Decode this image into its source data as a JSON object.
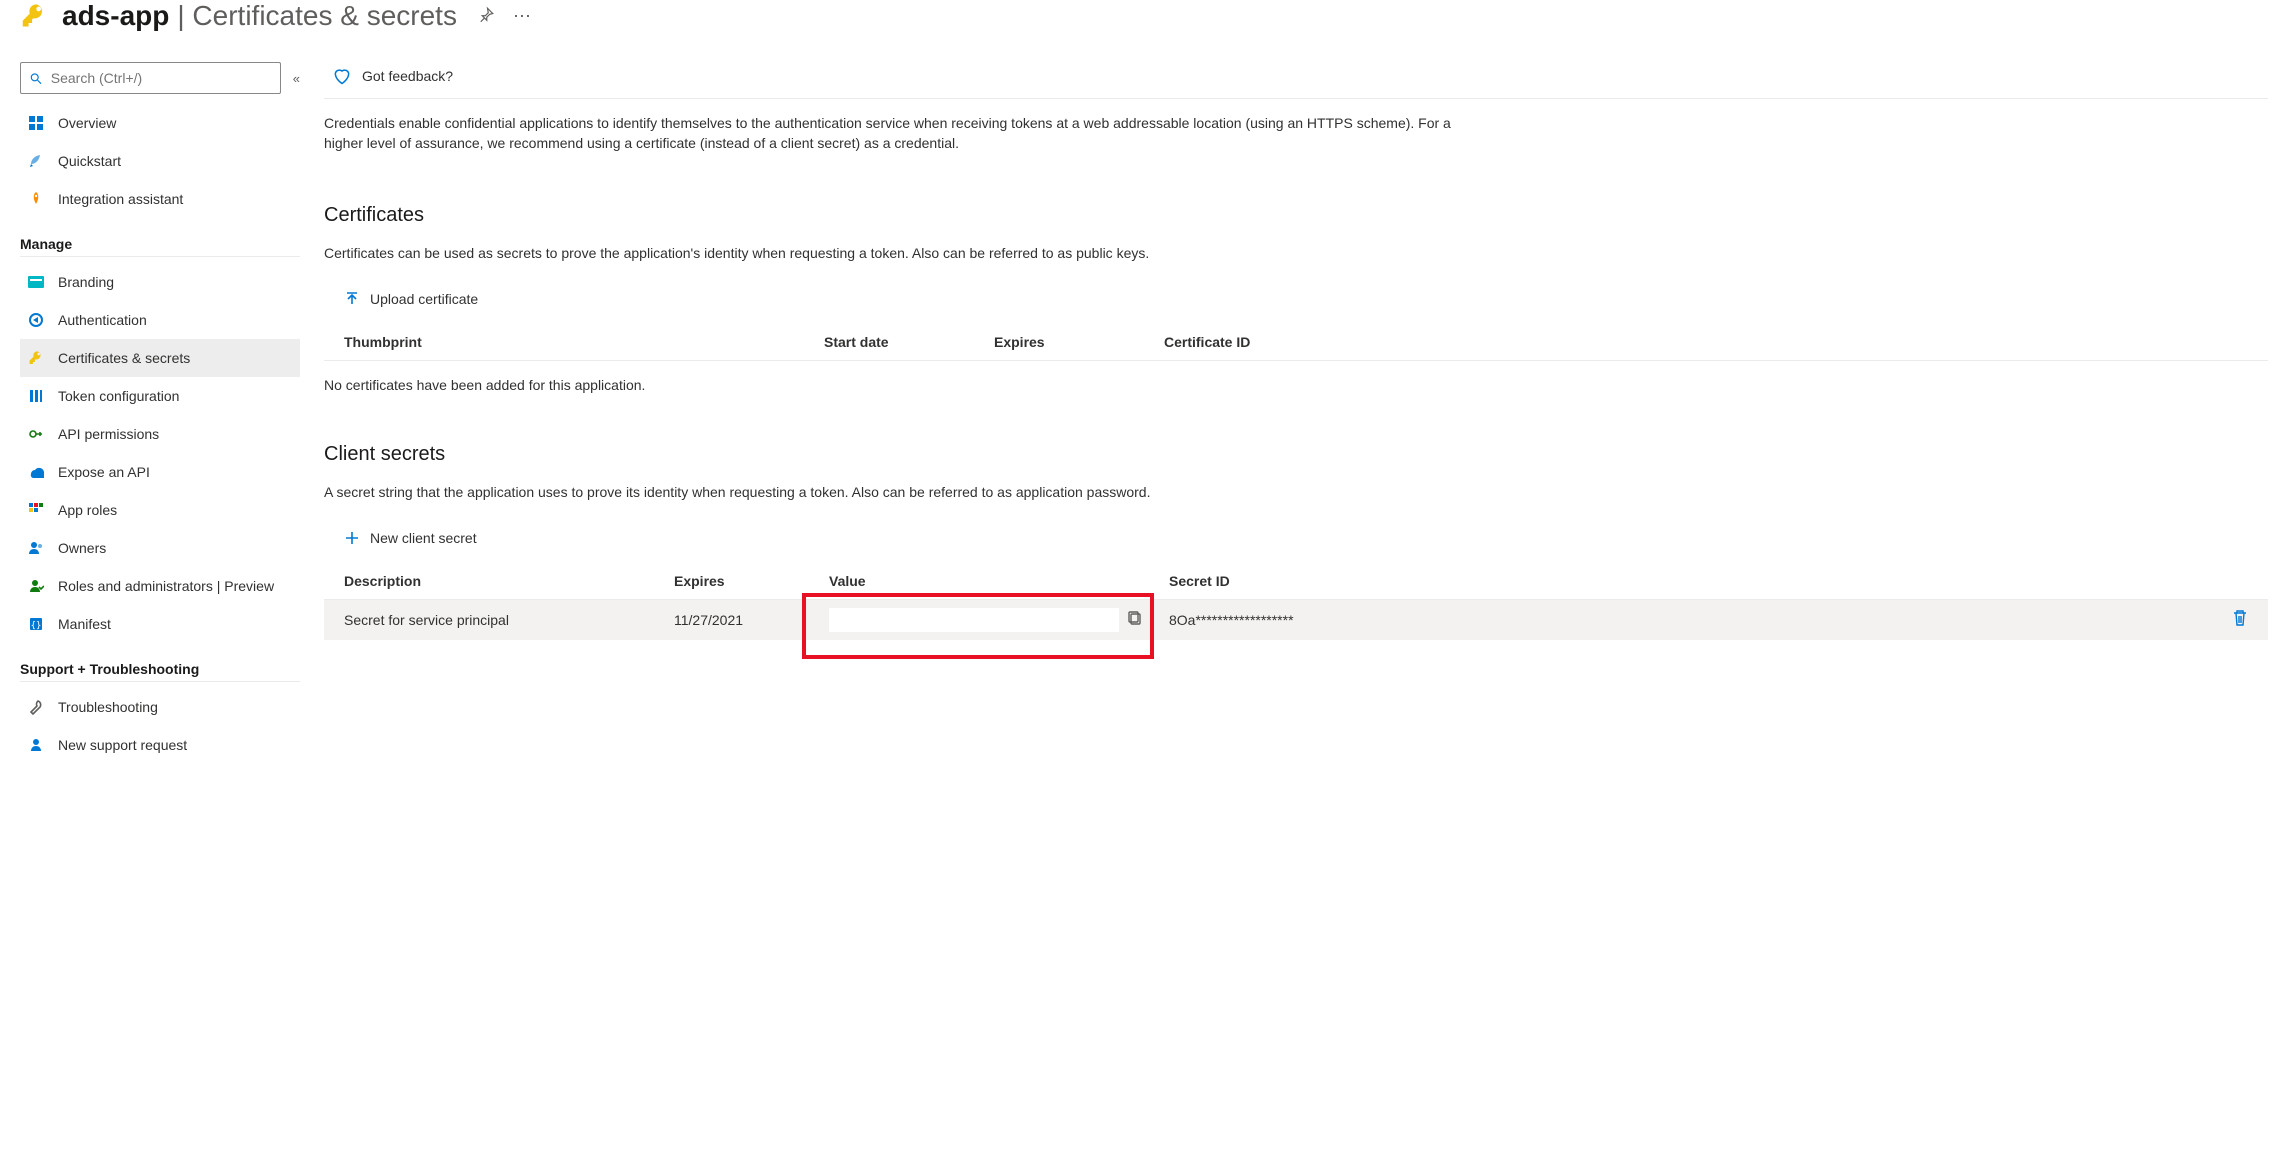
{
  "header": {
    "app_name": "ads-app",
    "page_title": "Certificates & secrets"
  },
  "sidebar": {
    "search_placeholder": "Search (Ctrl+/)",
    "top_items": [
      {
        "label": "Overview"
      },
      {
        "label": "Quickstart"
      },
      {
        "label": "Integration assistant"
      }
    ],
    "manage_label": "Manage",
    "manage_items": [
      {
        "label": "Branding"
      },
      {
        "label": "Authentication"
      },
      {
        "label": "Certificates & secrets"
      },
      {
        "label": "Token configuration"
      },
      {
        "label": "API permissions"
      },
      {
        "label": "Expose an API"
      },
      {
        "label": "App roles"
      },
      {
        "label": "Owners"
      },
      {
        "label": "Roles and administrators | Preview"
      },
      {
        "label": "Manifest"
      }
    ],
    "support_label": "Support + Troubleshooting",
    "support_items": [
      {
        "label": "Troubleshooting"
      },
      {
        "label": "New support request"
      }
    ]
  },
  "main": {
    "feedback_label": "Got feedback?",
    "intro": "Credentials enable confidential applications to identify themselves to the authentication service when receiving tokens at a web addressable location (using an HTTPS scheme). For a higher level of assurance, we recommend using a certificate (instead of a client secret) as a credential.",
    "certificates": {
      "title": "Certificates",
      "desc": "Certificates can be used as secrets to prove the application's identity when requesting a token. Also can be referred to as public keys.",
      "upload_label": "Upload certificate",
      "columns": {
        "thumb": "Thumbprint",
        "start": "Start date",
        "expires": "Expires",
        "id": "Certificate ID"
      },
      "empty": "No certificates have been added for this application."
    },
    "secrets": {
      "title": "Client secrets",
      "desc": "A secret string that the application uses to prove its identity when requesting a token. Also can be referred to as application password.",
      "new_label": "New client secret",
      "columns": {
        "desc": "Description",
        "expires": "Expires",
        "value": "Value",
        "id": "Secret ID"
      },
      "rows": [
        {
          "description": "Secret for service principal",
          "expires": "11/27/2021",
          "value": "",
          "secret_id": "8Oa******************"
        }
      ]
    }
  }
}
